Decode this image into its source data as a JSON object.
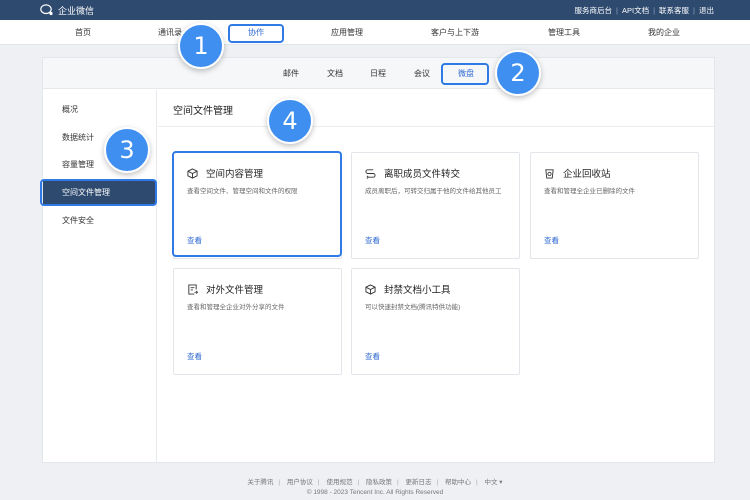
{
  "brand": {
    "name": "企业微信"
  },
  "top_links": [
    "服务商后台",
    "API文档",
    "联系客服",
    "退出"
  ],
  "main_nav": [
    {
      "label": "首页",
      "active": false
    },
    {
      "label": "通讯录",
      "active": false
    },
    {
      "label": "协作",
      "active": true
    },
    {
      "label": "应用管理",
      "active": false
    },
    {
      "label": "客户与上下游",
      "active": false
    },
    {
      "label": "管理工具",
      "active": false
    },
    {
      "label": "我的企业",
      "active": false
    }
  ],
  "sub_nav": [
    {
      "label": "邮件",
      "active": false
    },
    {
      "label": "文档",
      "active": false
    },
    {
      "label": "日程",
      "active": false
    },
    {
      "label": "会议",
      "active": false
    },
    {
      "label": "微盘",
      "active": true
    }
  ],
  "sidebar": [
    {
      "label": "概况",
      "active": false
    },
    {
      "label": "数据统计",
      "active": false
    },
    {
      "label": "容量管理",
      "active": false
    },
    {
      "label": "空间文件管理",
      "active": true
    },
    {
      "label": "文件安全",
      "active": false
    }
  ],
  "content": {
    "title": "空间文件管理",
    "cards": [
      {
        "icon": "cube-icon",
        "title": "空间内容管理",
        "desc": "查看空间文件、管理空间和文件的权限",
        "link": "查看"
      },
      {
        "icon": "transfer-icon",
        "title": "离职成员文件转交",
        "desc": "成员离职后，可转交归属于他的文件给其他员工",
        "link": "查看"
      },
      {
        "icon": "recycle-bin-icon",
        "title": "企业回收站",
        "desc": "查看和管理全企业已删除的文件",
        "link": "查看"
      },
      {
        "icon": "external-file-icon",
        "title": "对外文件管理",
        "desc": "查看和管理全企业对外分享的文件",
        "link": "查看"
      },
      {
        "icon": "cube-icon",
        "title": "封禁文档小工具",
        "desc": "可以快速封禁文档(腾讯特供功能)",
        "link": "查看"
      }
    ]
  },
  "annotations": [
    "1",
    "2",
    "3",
    "4"
  ],
  "footer": {
    "links": [
      "关于腾讯",
      "用户协议",
      "使用规范",
      "隐私政策",
      "更新日志",
      "帮助中心",
      "中文 ▾"
    ],
    "copyright": "© 1998 - 2023 Tencent Inc. All Rights Reserved"
  },
  "colors": {
    "topbar": "#2e4a6f",
    "accent": "#2e6ad1",
    "highlight": "#2f7ae5",
    "badge": "#3f8ff0"
  }
}
